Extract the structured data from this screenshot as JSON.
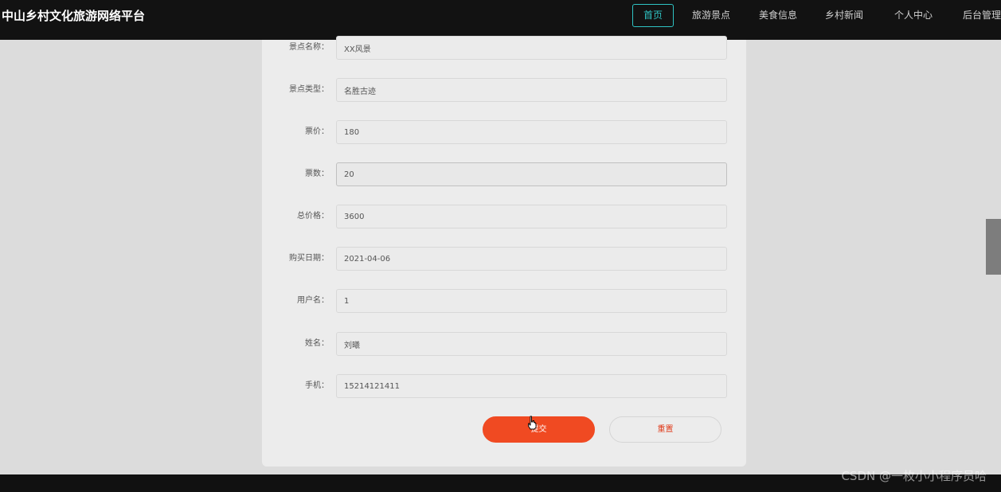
{
  "header": {
    "site_title": "中山乡村文化旅游网络平台",
    "nav": [
      {
        "label": "首页",
        "active": true
      },
      {
        "label": "旅游景点",
        "active": false
      },
      {
        "label": "美食信息",
        "active": false
      },
      {
        "label": "乡村新闻",
        "active": false
      },
      {
        "label": "个人中心",
        "active": false
      },
      {
        "label": "后台管理",
        "active": false
      }
    ]
  },
  "form": {
    "fields": [
      {
        "label": "景点名称：",
        "value": "XX风景"
      },
      {
        "label": "景点类型：",
        "value": "名胜古迹"
      },
      {
        "label": "票价：",
        "value": "180"
      },
      {
        "label": "票数：",
        "value": "20"
      },
      {
        "label": "总价格：",
        "value": "3600"
      },
      {
        "label": "购买日期：",
        "value": "2021-04-06"
      },
      {
        "label": "用户名：",
        "value": "1"
      },
      {
        "label": "姓名：",
        "value": "刘曦"
      },
      {
        "label": "手机：",
        "value": "15214121411"
      }
    ],
    "submit_label": "提交",
    "reset_label": "重置"
  },
  "watermark": "CSDN @一枚小小程序员哈",
  "colors": {
    "accent_teal": "#2fc4c4",
    "submit_orange": "#f04a22",
    "header_bg": "#121212"
  }
}
